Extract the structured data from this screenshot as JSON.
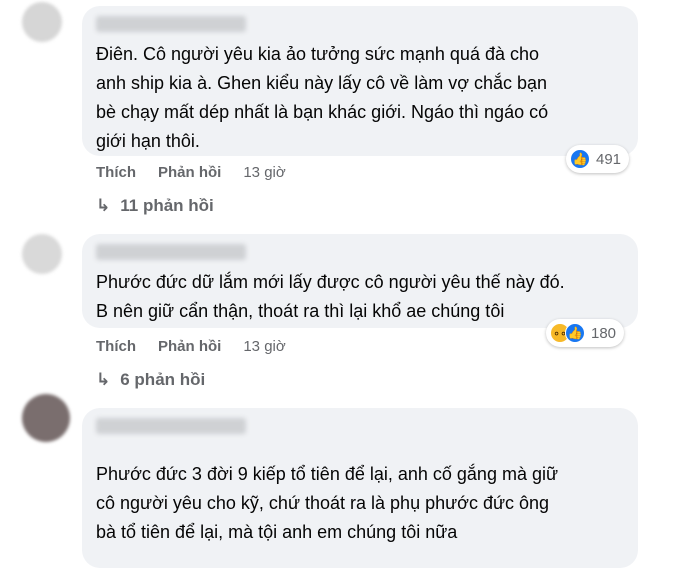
{
  "comments": [
    {
      "text": "Điên. Cô người yêu kia ảo tưởng sức mạnh quá đà cho\nanh ship kia à. Ghen kiểu này lấy cô về làm vợ chắc bạn\nbè chạy mất dép nhất là bạn khác giới. Ngáo thì ngáo có\ngiới hạn thôi.",
      "like_label": "Thích",
      "reply_label": "Phản hồi",
      "time": "13 giờ",
      "reactions": [
        "like-icon"
      ],
      "reaction_count": "491",
      "replies_label": "11 phản hồi"
    },
    {
      "text": "Phước đức dữ lắm mới lấy được cô người yêu thế này đó.\nB nên giữ cẩn thận, thoát ra thì lại khổ ae chúng tôi",
      "like_label": "Thích",
      "reply_label": "Phản hồi",
      "time": "13 giờ",
      "reactions": [
        "haha-icon",
        "like-icon"
      ],
      "reaction_count": "180",
      "replies_label": "6 phản hồi"
    },
    {
      "text": "Phước đức 3 đời 9 kiếp tổ tiên để lại, anh cố gắng mà giữ\ncô người yêu cho kỹ, chứ thoát ra là phụ phước đức ông\nbà tổ tiên để lại, mà tội anh em chúng tôi nữa"
    }
  ]
}
